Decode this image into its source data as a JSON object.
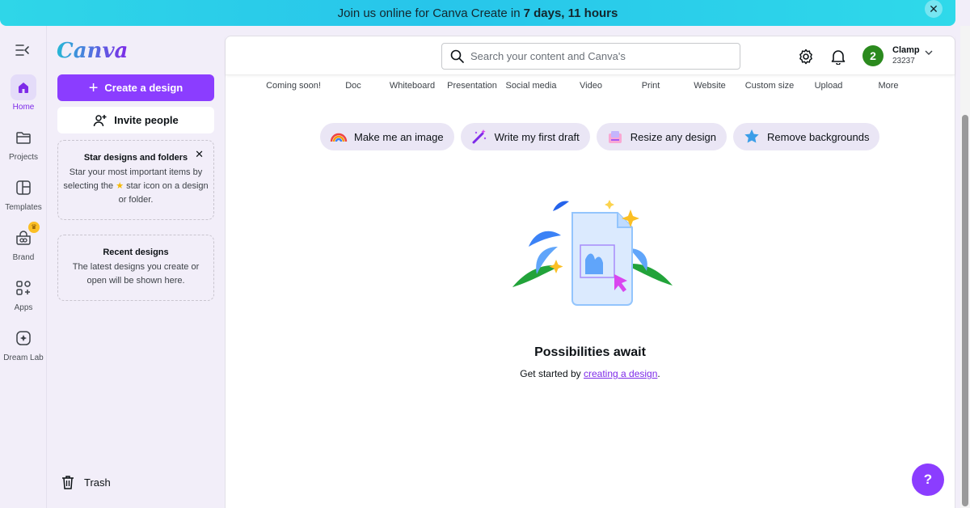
{
  "banner": {
    "text": "Join us online for Canva Create in",
    "highlight": "7 days, 11 hours",
    "close_symbol": "✕"
  },
  "rail": {
    "items": [
      {
        "label": "Home",
        "icon": "home-icon"
      },
      {
        "label": "Projects",
        "icon": "folder-icon"
      },
      {
        "label": "Templates",
        "icon": "templates-icon"
      },
      {
        "label": "Brand",
        "icon": "brand-icon"
      },
      {
        "label": "Apps",
        "icon": "apps-icon"
      },
      {
        "label": "Dream Lab",
        "icon": "dream-lab-icon"
      }
    ]
  },
  "panel": {
    "logo": "Canva",
    "create_label": "Create a design",
    "invite_label": "Invite people",
    "star_card": {
      "title": "Star designs and folders",
      "body_before": "Star your most important items by selecting the",
      "body_after": "star icon on a design or folder."
    },
    "recent_card": {
      "title": "Recent designs",
      "body": "The latest designs you create or open will be shown here."
    },
    "trash_label": "Trash"
  },
  "header": {
    "search_placeholder": "Search your content and Canva's",
    "user": {
      "initial": "2",
      "name": "Clamp",
      "id": "23237"
    }
  },
  "categories": [
    "Coming soon!",
    "Doc",
    "Whiteboard",
    "Presentation",
    "Social media",
    "Video",
    "Print",
    "Website",
    "Custom size",
    "Upload",
    "More"
  ],
  "quick_actions": [
    {
      "label": "Make me an image",
      "icon": "rainbow-icon"
    },
    {
      "label": "Write my first draft",
      "icon": "magic-pen-icon"
    },
    {
      "label": "Resize any design",
      "icon": "resize-icon"
    },
    {
      "label": "Remove backgrounds",
      "icon": "star-icon"
    }
  ],
  "empty_state": {
    "title": "Possibilities await",
    "subtitle_before": "Get started by",
    "link": "creating a design",
    "subtitle_after": "."
  },
  "help_label": "?",
  "colors": {
    "accent": "#8b3dff",
    "banner": "#2fd6e8",
    "avatar": "#2b8a1e"
  }
}
